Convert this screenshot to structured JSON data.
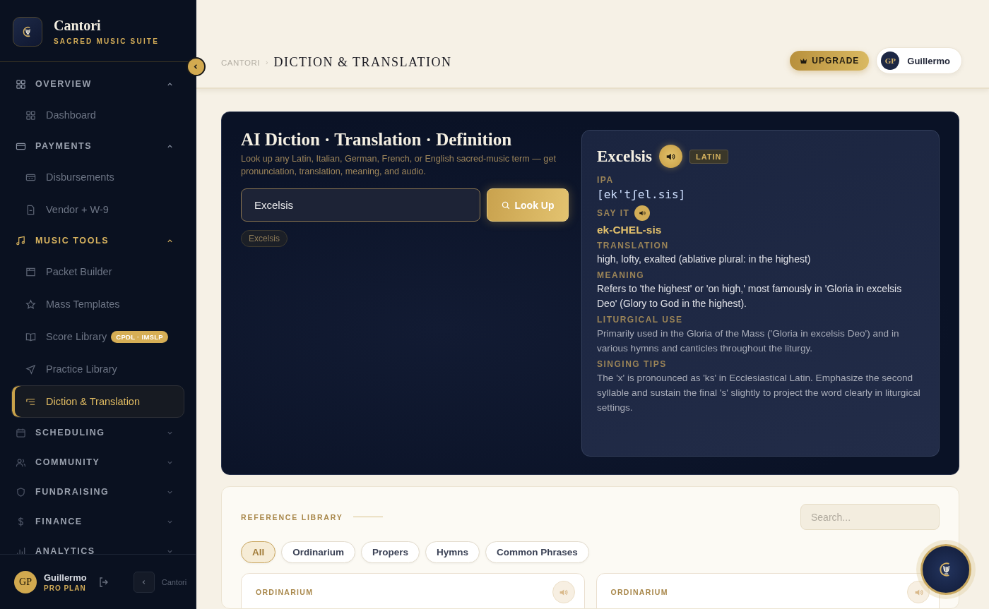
{
  "brand": {
    "name": "Cantori",
    "tagline": "SACRED MUSIC SUITE"
  },
  "sidebar": {
    "groups": [
      {
        "label": "OVERVIEW",
        "expanded": true,
        "active": false,
        "items": [
          {
            "label": "Dashboard",
            "selected": false
          }
        ]
      },
      {
        "label": "PAYMENTS",
        "expanded": true,
        "active": false,
        "items": [
          {
            "label": "Disbursements",
            "selected": false
          },
          {
            "label": "Vendor + W-9",
            "selected": false
          }
        ]
      },
      {
        "label": "MUSIC TOOLS",
        "expanded": true,
        "active": true,
        "items": [
          {
            "label": "Packet Builder",
            "selected": false
          },
          {
            "label": "Mass Templates",
            "selected": false
          },
          {
            "label": "Score Library",
            "selected": false,
            "badge": "CPDL · IMSLP"
          },
          {
            "label": "Practice Library",
            "selected": false
          },
          {
            "label": "Diction & Translation",
            "selected": true
          }
        ]
      },
      {
        "label": "SCHEDULING",
        "expanded": false,
        "active": false
      },
      {
        "label": "COMMUNITY",
        "expanded": false,
        "active": false
      },
      {
        "label": "FUNDRAISING",
        "expanded": false,
        "active": false
      },
      {
        "label": "FINANCE",
        "expanded": false,
        "active": false
      },
      {
        "label": "ANALYTICS",
        "expanded": false,
        "active": false
      }
    ],
    "user": {
      "initials": "GP",
      "name": "Guillermo",
      "plan": "PRO PLAN"
    },
    "footer_label": "Cantori"
  },
  "header": {
    "breadcrumb_root": "CANTORI",
    "breadcrumb_separator": "›",
    "title": "DICTION & TRANSLATION",
    "upgrade_label": "UPGRADE",
    "user": {
      "initials": "GP",
      "name": "Guillermo"
    }
  },
  "lookup": {
    "title": "AI Diction · Translation · Definition",
    "subtitle": "Look up any Latin, Italian, German, French, or English sacred-music term — get pronunciation, translation, meaning, and audio.",
    "query": "Excelsis",
    "button": "Look Up",
    "recent": [
      "Excelsis"
    ]
  },
  "result": {
    "word": "Excelsis",
    "language": "LATIN",
    "sections": [
      {
        "kind": "ipa",
        "label": "IPA",
        "text": "[ek'tʃel.sis]"
      },
      {
        "kind": "say",
        "label": "SAY IT",
        "text": "ek-CHEL-sis"
      },
      {
        "kind": "primary",
        "label": "TRANSLATION",
        "text": "high, lofty, exalted (ablative plural: in the highest)"
      },
      {
        "kind": "primary",
        "label": "MEANING",
        "text": "Refers to 'the highest' or 'on high,' most famously in 'Gloria in excelsis Deo' (Glory to God in the highest)."
      },
      {
        "kind": "secondary",
        "label": "LITURGICAL USE",
        "text": "Primarily used in the Gloria of the Mass ('Gloria in excelsis Deo') and in various hymns and canticles throughout the liturgy."
      },
      {
        "kind": "secondary",
        "label": "SINGING TIPS",
        "text": "The 'x' is pronounced as 'ks' in Ecclesiastical Latin. Emphasize the second syllable and sustain the final 's' slightly to project the word clearly in liturgical settings."
      }
    ]
  },
  "library": {
    "title": "REFERENCE LIBRARY",
    "search_placeholder": "Search...",
    "filters": [
      {
        "label": "All",
        "selected": true
      },
      {
        "label": "Ordinarium",
        "selected": false
      },
      {
        "label": "Propers",
        "selected": false
      },
      {
        "label": "Hymns",
        "selected": false
      },
      {
        "label": "Common Phrases",
        "selected": false
      }
    ],
    "cards": [
      {
        "category": "ORDINARIUM"
      },
      {
        "category": "ORDINARIUM"
      }
    ]
  }
}
